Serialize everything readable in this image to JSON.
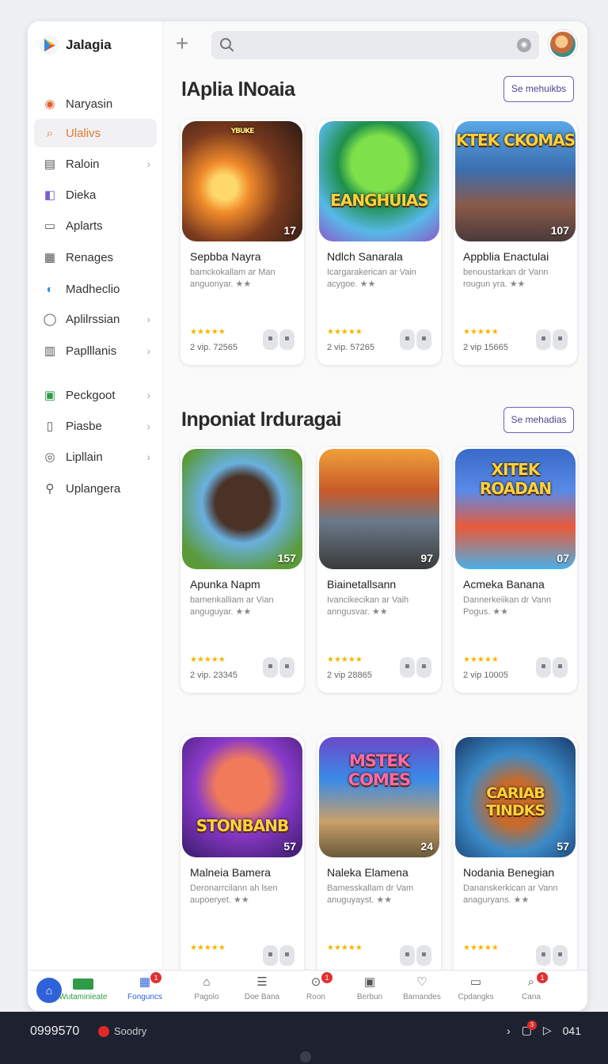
{
  "app": {
    "name": "Jalagia"
  },
  "sidebar": {
    "items": [
      {
        "label": "Narуasin",
        "icon": "orange-app-icon",
        "active": false,
        "chevron": false
      },
      {
        "label": "Ulalivs",
        "icon": "search-icon",
        "active": true,
        "chevron": false
      },
      {
        "label": "Raloin",
        "icon": "book-icon",
        "active": false,
        "chevron": true
      },
      {
        "label": "Dieka",
        "icon": "purple-square-icon",
        "active": false,
        "chevron": false
      },
      {
        "label": "Aplarts",
        "icon": "window-icon",
        "active": false,
        "chevron": false
      },
      {
        "label": "Renages",
        "icon": "grid-icon",
        "active": false,
        "chevron": false
      },
      {
        "label": "Madheclio",
        "icon": "colorful-app-icon",
        "active": false,
        "chevron": false
      },
      {
        "label": "Aplilrssian",
        "icon": "chat-icon",
        "active": false,
        "chevron": true
      },
      {
        "label": "Paplllanis",
        "icon": "bars-icon",
        "active": false,
        "chevron": true
      },
      {
        "label": "Peckgoot",
        "icon": "store-icon",
        "active": false,
        "chevron": true
      },
      {
        "label": "Piasbe",
        "icon": "document-icon",
        "active": false,
        "chevron": true
      },
      {
        "label": "Lipllain",
        "icon": "globe-icon",
        "active": false,
        "chevron": true
      },
      {
        "label": "Uplangera",
        "icon": "user-icon",
        "active": false,
        "chevron": false
      }
    ]
  },
  "search": {
    "placeholder": "",
    "value": ""
  },
  "sections": [
    {
      "title": "lAplia lNoaia",
      "see_more": "Se mehuikbs",
      "cards": [
        {
          "title": "Sepbba Nayra",
          "desc": "bamckokallam ar Man anguonyar. ★★",
          "downloads": "2 vip. 72565",
          "badge": "17",
          "art_text": "YBUKE",
          "art": "war"
        },
        {
          "title": "Ndlch Sanarala",
          "desc": "Icargarakerican ar Vain acygoe. ★★",
          "downloads": "2 vip. 57265",
          "badge": "",
          "art_text": "EANGHUIAS",
          "art": "green"
        },
        {
          "title": "Appblia Enactulai",
          "desc": "benoustarkan dr Vann rougun yra. ★★",
          "downloads": "2 vip 15665",
          "badge": "107",
          "art_text": "KTEK CKOMAS",
          "art": "city"
        }
      ]
    },
    {
      "title": "Inponiat lrduragai",
      "see_more": "Se mehadias",
      "cards": [
        {
          "title": "Apunka Napm",
          "desc": "bamenkalliam ar Vian anguguyar. ★★",
          "downloads": "2 vip. 23345",
          "badge": "157",
          "art_text": "",
          "art": "bear"
        },
        {
          "title": "Biainetallsann",
          "desc": "Ivancikecikan ar Vaih anngusvar. ★★",
          "downloads": "2 vip 28865",
          "badge": "97",
          "art_text": "",
          "art": "car"
        },
        {
          "title": "Acmeka Banana",
          "desc": "Dannerkeiikan dr Vann Pogus. ★★",
          "downloads": "2 vip 10005",
          "badge": "07",
          "art_text": "XITEK ROADAN",
          "art": "road"
        }
      ]
    },
    {
      "title": "",
      "see_more": "",
      "cards": [
        {
          "title": "Malneia Bamera",
          "desc": "Deronarrcilann ah lsen aupoeryet. ★★",
          "downloads": "",
          "badge": "57",
          "art_text": "STONBANB",
          "art": "cat"
        },
        {
          "title": "Naleka Elamena",
          "desc": "Bamesskallam dr Vam anuguyayst. ★★",
          "downloads": "",
          "badge": "24",
          "art_text": "MSTEK COMES",
          "art": "box"
        },
        {
          "title": "Nodania Benegian",
          "desc": "Dananskerkican ar Vann anaguryans. ★★",
          "downloads": "",
          "badge": "57",
          "art_text": "CARIAB TINDKS",
          "art": "people"
        }
      ]
    }
  ],
  "stars": "★★★★★",
  "bottom_nav": [
    {
      "label": "Wutaminieate",
      "icon": "green-tag-icon",
      "badge": "",
      "style": "active"
    },
    {
      "label": "Fonguncs",
      "icon": "calendar-icon",
      "badge": "1",
      "style": "blue"
    },
    {
      "label": "Pagolo",
      "icon": "home-icon",
      "badge": "",
      "style": ""
    },
    {
      "label": "Doe Bana",
      "icon": "list-icon",
      "badge": "",
      "style": ""
    },
    {
      "label": "Roon",
      "icon": "gamepad-icon",
      "badge": "1",
      "style": ""
    },
    {
      "label": "Berbun",
      "icon": "image-icon",
      "badge": "",
      "style": ""
    },
    {
      "label": "Bamandes",
      "icon": "heart-icon",
      "badge": "",
      "style": ""
    },
    {
      "label": "Cpdangks",
      "icon": "message-icon",
      "badge": "",
      "style": ""
    },
    {
      "label": "Cana",
      "icon": "search-icon",
      "badge": "1",
      "style": ""
    }
  ],
  "taskbar": {
    "time_left": "0999570",
    "recording_label": "Soodry",
    "time_right": "041",
    "notif_count": "3"
  },
  "colors": {
    "accent": "#e37a2f",
    "brand_blue": "#2f62d9",
    "active_green": "#2f9b47",
    "see_more_border": "#6a63b5"
  }
}
